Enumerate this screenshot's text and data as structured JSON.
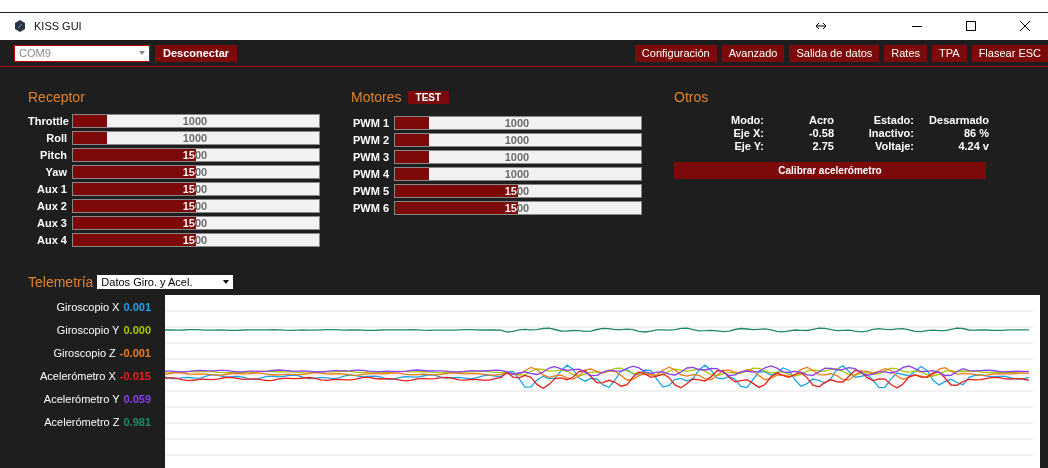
{
  "window": {
    "title": "KISS GUI"
  },
  "toolbar": {
    "port": {
      "value": "COM9"
    },
    "connect_button": "Desconectar",
    "tabs": [
      {
        "label": "Configuración",
        "selected": false
      },
      {
        "label": "Avanzado",
        "selected": false
      },
      {
        "label": "Salida de datos",
        "selected": false
      },
      {
        "label": "Rates",
        "selected": false
      },
      {
        "label": "TPA",
        "selected": false
      },
      {
        "label": "Flasear ESC",
        "selected": false
      }
    ]
  },
  "receptor": {
    "title": "Receptor",
    "channels": [
      {
        "name": "Throttle",
        "value": "1000",
        "level": 0.14
      },
      {
        "name": "Roll",
        "value": "1000",
        "level": 0.14
      },
      {
        "name": "Pitch",
        "value": "1500",
        "level": 0.5
      },
      {
        "name": "Yaw",
        "value": "1500",
        "level": 0.5
      },
      {
        "name": "Aux 1",
        "value": "1500",
        "level": 0.5
      },
      {
        "name": "Aux 2",
        "value": "1500",
        "level": 0.5
      },
      {
        "name": "Aux 3",
        "value": "1500",
        "level": 0.5
      },
      {
        "name": "Aux 4",
        "value": "1500",
        "level": 0.5
      }
    ]
  },
  "motores": {
    "title": "Motores",
    "test_button": "TEST",
    "channels": [
      {
        "name": "PWM 1",
        "value": "1000",
        "level": 0.14
      },
      {
        "name": "PWM 2",
        "value": "1000",
        "level": 0.14
      },
      {
        "name": "PWM 3",
        "value": "1000",
        "level": 0.14
      },
      {
        "name": "PWM 4",
        "value": "1000",
        "level": 0.14
      },
      {
        "name": "PWM 5",
        "value": "1500",
        "level": 0.5
      },
      {
        "name": "PWM 6",
        "value": "1500",
        "level": 0.5
      }
    ]
  },
  "otros": {
    "title": "Otros",
    "stats": [
      {
        "label": "Modo:",
        "value": "Acro"
      },
      {
        "label": "Estado:",
        "value": "Desarmado"
      },
      {
        "label": "Eje X:",
        "value": "-0.58"
      },
      {
        "label": "Inactivo:",
        "value": "86 %"
      },
      {
        "label": "Eje Y:",
        "value": "2.75"
      },
      {
        "label": "Voltaje:",
        "value": "4.24 v"
      }
    ],
    "calibrate_button": "Calibrar acelerómetro"
  },
  "telemetry": {
    "title": "Telemetría",
    "select": {
      "value": "Datos Giro. y Acel."
    },
    "series": [
      {
        "name": "Giroscopio X",
        "value": "0.001",
        "color": "#1aa3e8"
      },
      {
        "name": "Giroscopio Y",
        "value": "0.000",
        "color": "#a8c800"
      },
      {
        "name": "Giroscopio Z",
        "value": "-0.001",
        "color": "#f07c1a"
      },
      {
        "name": "Acelerómetro X",
        "value": "-0.015",
        "color": "#e8201a"
      },
      {
        "name": "Acelerómetro Y",
        "value": "0.059",
        "color": "#8a3ff0"
      },
      {
        "name": "Acelerómetro Z",
        "value": "0.981",
        "color": "#1f8a6a"
      }
    ]
  }
}
